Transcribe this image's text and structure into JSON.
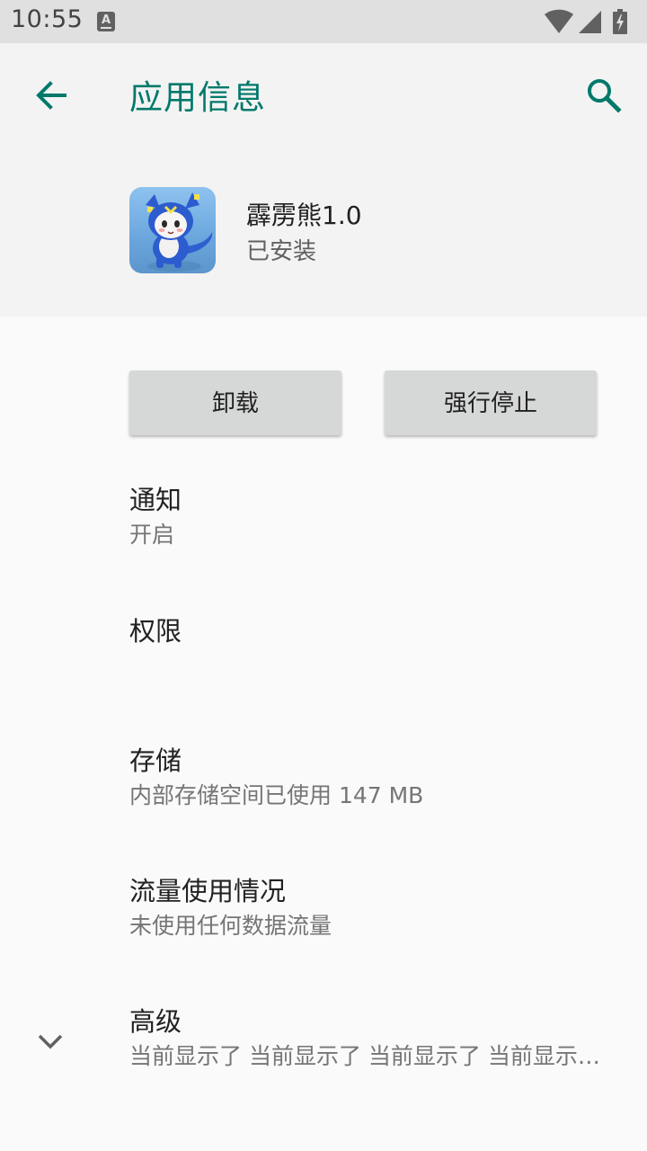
{
  "status_bar": {
    "time": "10:55",
    "notification_icon": "a-keyboard-icon",
    "icons": [
      "wifi-icon",
      "signal-icon",
      "battery-charging-icon"
    ]
  },
  "app_bar": {
    "title": "应用信息",
    "back_icon": "arrow-back-icon",
    "search_icon": "search-icon",
    "accent_color": "#00796b"
  },
  "app": {
    "name": "霹雳熊1.0",
    "status": "已安装"
  },
  "actions": {
    "uninstall": "卸载",
    "force_stop": "强行停止"
  },
  "prefs": {
    "notifications": {
      "title": "通知",
      "summary": "开启"
    },
    "permissions": {
      "title": "权限"
    },
    "storage": {
      "title": "存储",
      "summary": "内部存储空间已使用 147 MB"
    },
    "data_usage": {
      "title": "流量使用情况",
      "summary": "未使用任何数据流量"
    },
    "advanced": {
      "title": "高级",
      "summary": "当前显示了 当前显示了 当前显示了 当前显示了 当前显示了"
    }
  }
}
